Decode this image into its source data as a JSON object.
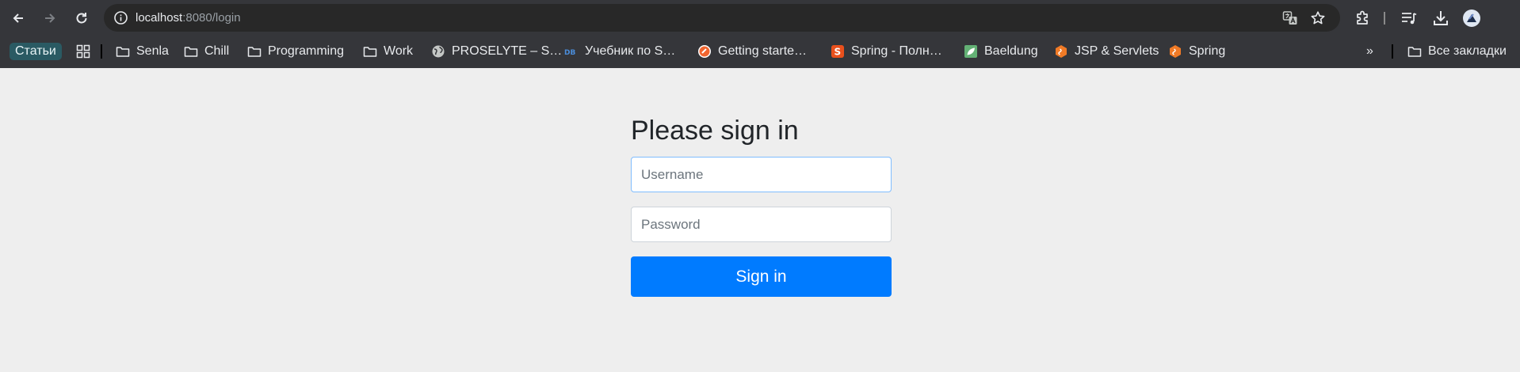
{
  "browser": {
    "url_host": "localhost",
    "url_path": ":8080/login",
    "icons": [
      "back-icon",
      "forward-icon",
      "reload-icon",
      "info-icon",
      "translate-icon",
      "star-icon",
      "extensions-icon",
      "media-icon",
      "download-icon",
      "profile-icon"
    ]
  },
  "bookmarks": {
    "chip": "Статьи",
    "items": [
      {
        "label": "Senla",
        "icon": "folder-icon"
      },
      {
        "label": "Chill",
        "icon": "folder-icon"
      },
      {
        "label": "Programming",
        "icon": "folder-icon"
      },
      {
        "label": "Work",
        "icon": "folder-icon"
      },
      {
        "label": "PROSELYTE – S…",
        "icon": "globe-icon"
      },
      {
        "label": "Учебник по S…",
        "icon": "db-icon"
      },
      {
        "label": "Getting starte…",
        "icon": "site-icon"
      },
      {
        "label": "Spring - Полн…",
        "icon": "s-icon"
      },
      {
        "label": "Baeldung",
        "icon": "leaf-icon"
      },
      {
        "label": "JSP & Servlets",
        "icon": "hex-icon"
      },
      {
        "label": "Spring",
        "icon": "hex-icon"
      }
    ],
    "overflow": "»",
    "all_bookmarks": "Все закладки"
  },
  "login": {
    "heading": "Please sign in",
    "username_placeholder": "Username",
    "username_value": "",
    "password_placeholder": "Password",
    "password_value": "",
    "submit_label": "Sign in"
  },
  "colors": {
    "page_bg": "#eeeeee",
    "chrome_bg": "#35363a",
    "button_primary": "#007bff",
    "focus_border": "#80bdff"
  }
}
